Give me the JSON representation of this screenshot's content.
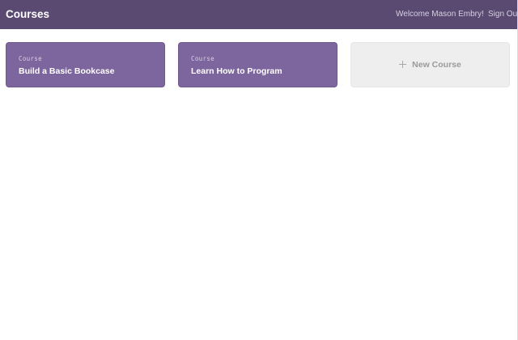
{
  "header": {
    "title": "Courses",
    "welcome": "Welcome Mason Embry!",
    "sign_out": "Sign Out"
  },
  "courses": [
    {
      "kicker": "Course",
      "title": "Build a Basic Bookcase"
    },
    {
      "kicker": "Course",
      "title": "Learn How to Program"
    }
  ],
  "new_course": {
    "icon": "plus-icon",
    "label": "New Course"
  },
  "colors": {
    "header_bg": "#5a4a72",
    "card_bg": "#7d669d",
    "new_card_bg": "#eeeeee"
  }
}
